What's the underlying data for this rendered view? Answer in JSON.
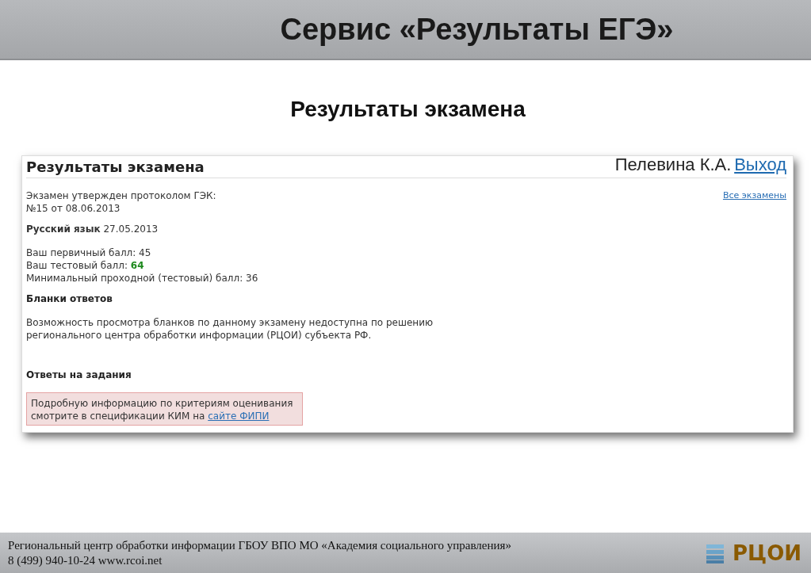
{
  "slide_title": "Сервис «Результаты ЕГЭ»",
  "slide_subtitle": "Результаты экзамена",
  "page": {
    "heading": "Результаты экзамена",
    "user": "Пелевина К.А.",
    "logout_link": "Выход",
    "all_exams_link": "Все экзамены",
    "protocol_lines": [
      "Экзамен утвержден протоколом ГЭК:",
      "№15 от 08.06.2013"
    ],
    "exam": "**Русский язык** 27.05.2013",
    "scores": [
      "Ваш первичный балл: 45",
      "Ваш тестовый балл: **64**",
      "Минимальный проходной (тестовый) балл: 36"
    ],
    "forms_heading": "Бланки ответов",
    "forms_text": [
      "Возможность просмотра бланков по данному экзамену недоступна по решению",
      "регионального центра обработки информации (РЦОИ) субъекта РФ."
    ],
    "answers_heading": "Ответы на задания",
    "note_lines": [
      "Подробную информацию по критериям оценивания",
      "смотрите в спецификации КИМ на"
    ],
    "note_link": "сайте ФИПИ"
  },
  "footer": {
    "lines": [
      "Региональный центр обработки информации ГБОУ ВПО МО «Академия социального управления»",
      "8 (499) 940-10-24 www.rcoi.net"
    ],
    "logo_text": "РЦОИ"
  }
}
